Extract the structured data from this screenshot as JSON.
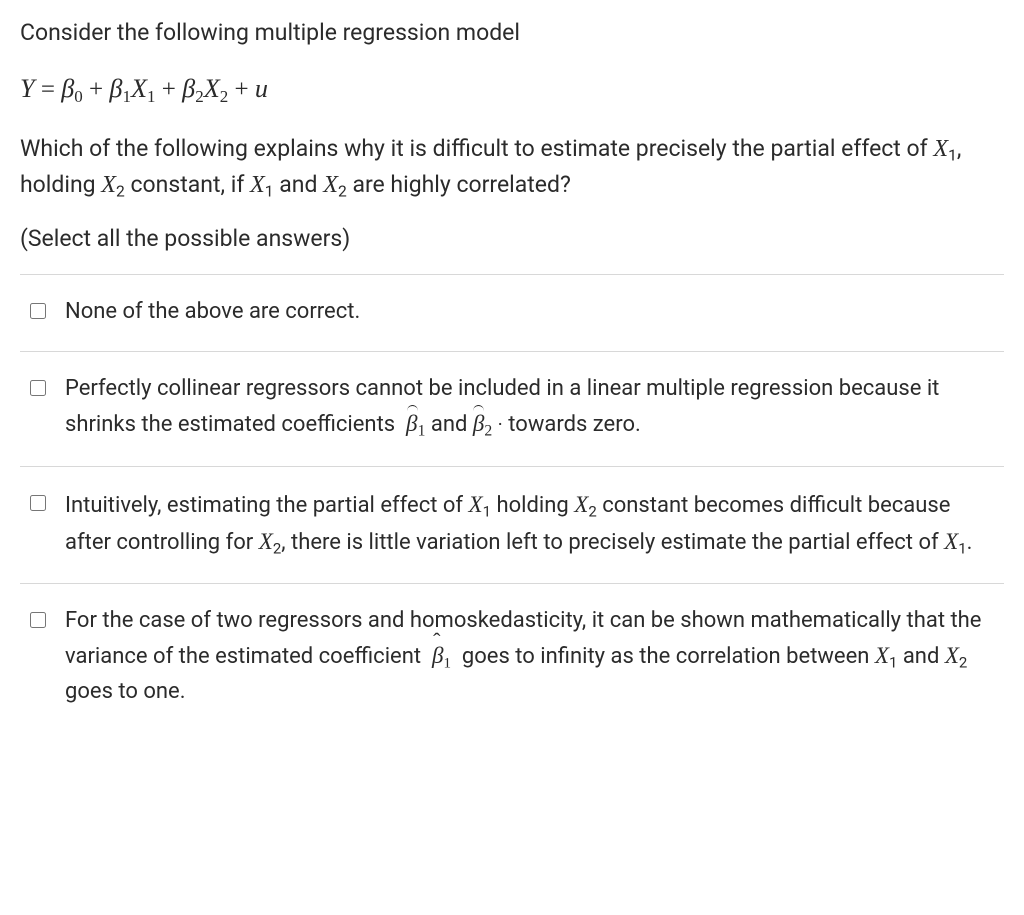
{
  "question": {
    "intro": "Consider the following multiple regression model",
    "equation_html": "<span class='mvar'>Y</span> <span class='rm'>=</span> <span class='mvar'>β</span><span class='sub'>0</span> <span class='rm'>+</span> <span class='mvar'>β</span><span class='sub'>1</span><span class='mvar'>X</span><span class='sub'>1</span> <span class='rm'>+</span> <span class='mvar'>β</span><span class='sub'>2</span><span class='mvar'>X</span><span class='sub'>2</span> <span class='rm'>+</span> <span class='mvar'>u</span>",
    "prompt_html": "Which of the following explains why it is difficult to estimate precisely the partial effect of <span class='mvar'>X</span><span class='sub'>1</span>, holding <span class='mvar'>X</span><span class='sub'>2</span> constant, if <span class='mvar'>X</span><span class='sub'>1</span> and <span class='mvar'>X</span><span class='sub'>2</span> are highly correlated?",
    "instruction": "(Select all the possible answers)"
  },
  "choices": [
    {
      "html": "None of the above are correct."
    },
    {
      "html": "Perfectly collinear regressors cannot be included in a linear multiple regression because it shrinks the estimated coefficients&nbsp; <span class='mvar'><span class='hat'>β</span><span class='sub' style='font-style:normal'>1</span></span> and <span class='mvar'><span class='hat'>β</span><span class='sub' style='font-style:normal'>2</span></span> <span style='font-size:0.9em'>·</span> towards zero."
    },
    {
      "html": "Intuitively, estimating the partial effect of <span class='mvar'>X</span><span class='sub'>1</span> holding <span class='mvar'>X</span><span class='sub'>2</span> constant becomes difficult because after controlling for <span class='mvar'>X</span><span class='sub'>2</span>, there is little variation left to precisely estimate the partial effect of <span class='mvar'>X</span><span class='sub'>1</span>."
    },
    {
      "html": "For the case of two regressors and homoskedasticity, it can be shown mathematically that the variance of the estimated coefficient&nbsp; <span class='mvar'><span class='caret'>β</span></span><span class='sub' style='font-family:\"Times New Roman\",serif'>1</span>&nbsp; goes to infinity as the correlation between <span class='mvar'>X</span><span class='sub'>1</span> and <span class='mvar'>X</span><span class='sub'>2</span> goes to one."
    }
  ]
}
